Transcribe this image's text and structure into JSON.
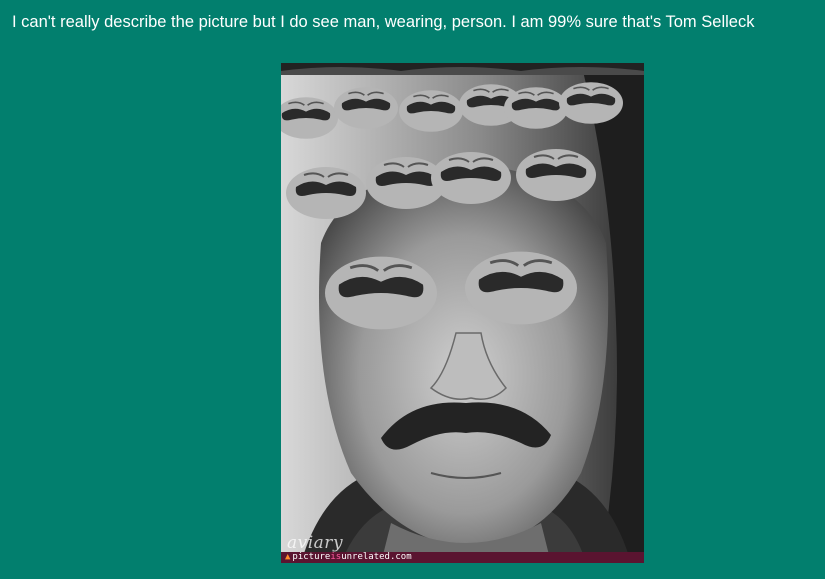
{
  "caption": "I can't really describe the picture but I do see man, wearing, person. I am 99% sure that's Tom Selleck",
  "image": {
    "watermark": "aviary",
    "site_prefix": "picture",
    "site_highlight": "is",
    "site_suffix": "unrelated.com"
  },
  "colors": {
    "background": "#027f6e",
    "text": "#ffffff",
    "footer_bar": "#5a1430"
  }
}
